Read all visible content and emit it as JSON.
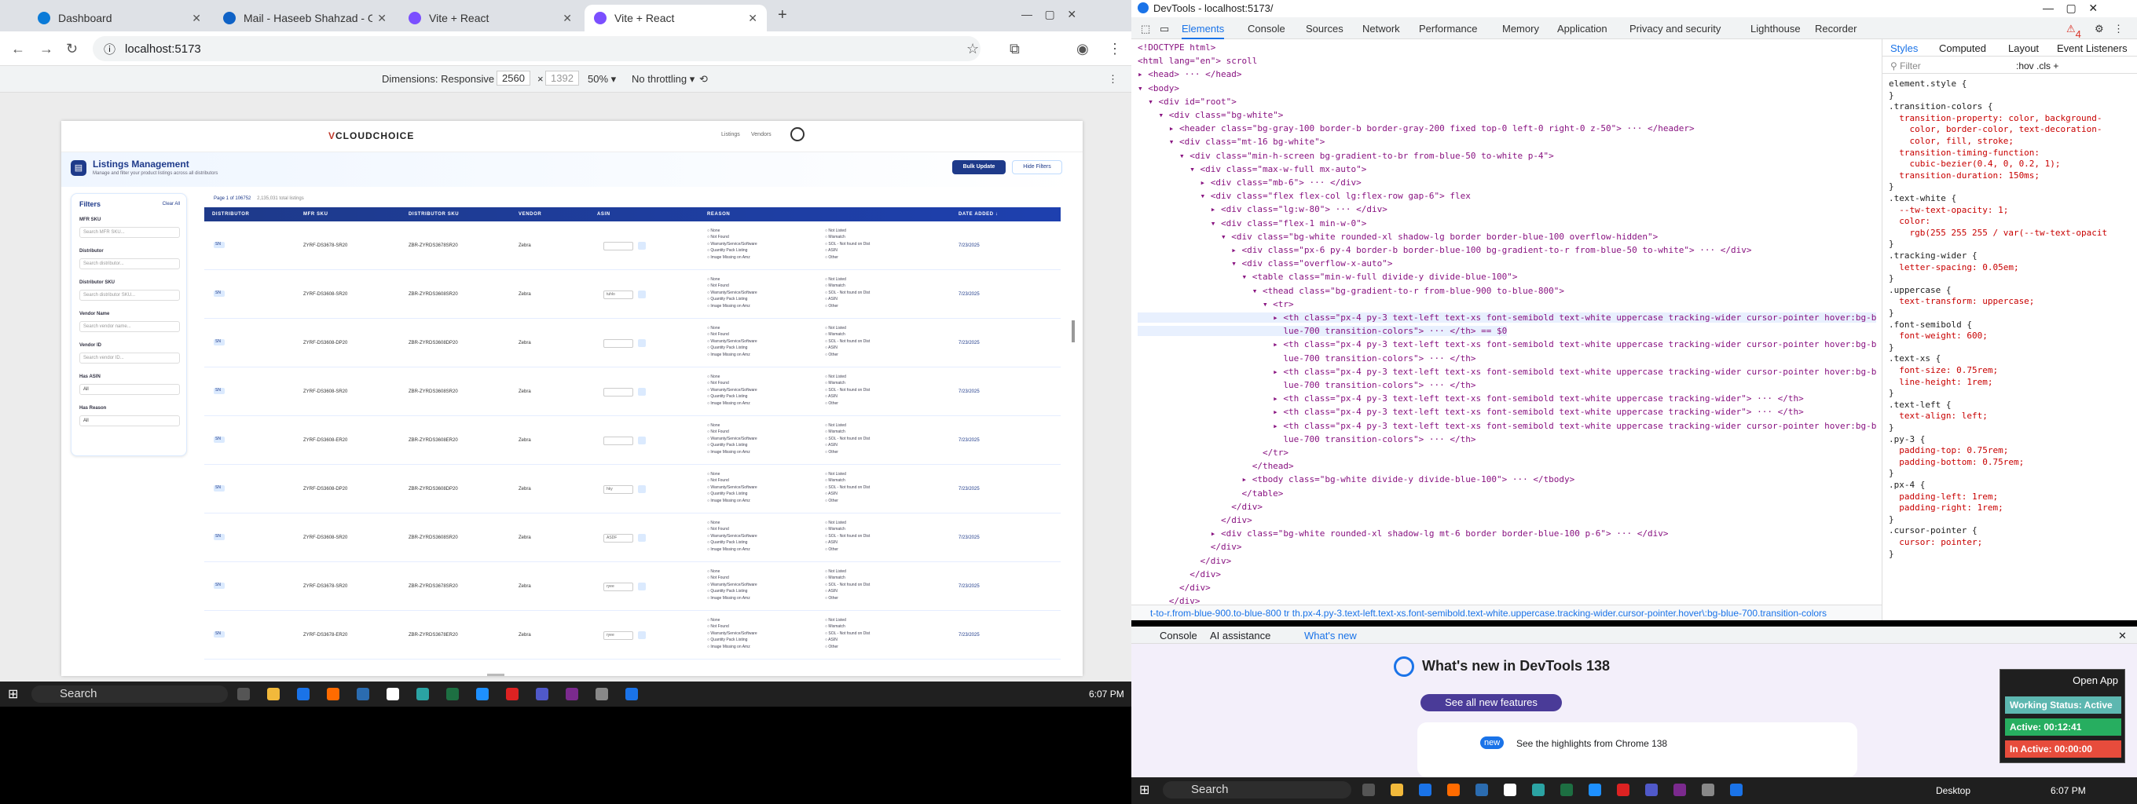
{
  "browser": {
    "tabs": [
      {
        "label": "Dashboard",
        "color": "#0b7bd8"
      },
      {
        "label": "Mail - Haseeb Shahzad - Outlo",
        "color": "#0f62c6"
      },
      {
        "label": "Vite + React",
        "color": "#7b4fff"
      },
      {
        "label": "Vite + React",
        "color": "#7b4fff"
      }
    ],
    "url": "localhost:5173",
    "device_toolbar": {
      "dimensions_label": "Dimensions: Responsive ▾",
      "width": "2560",
      "x": "×",
      "height": "1392",
      "zoom": "50% ▾",
      "throttle": "No throttling ▾"
    }
  },
  "app": {
    "logo_prefix": "V",
    "logo": "CLOUDCHOICE",
    "nav": [
      "Listings",
      "Vendors"
    ],
    "title": "Listings Management",
    "subtitle": "Manage and filter your product listings across all distributors",
    "bulk_button": "Bulk Update",
    "hide_filters_button": "Hide Filters",
    "filters": {
      "title": "Filters",
      "clear": "Clear All",
      "fields": [
        {
          "label": "MFR SKU",
          "placeholder": "Search MFR SKU..."
        },
        {
          "label": "Distributor",
          "placeholder": "Search distributor..."
        },
        {
          "label": "Distributor SKU",
          "placeholder": "Search distributor SKU..."
        },
        {
          "label": "Vendor Name",
          "placeholder": "Search vendor name..."
        },
        {
          "label": "Vendor ID",
          "placeholder": "Search vendor ID..."
        },
        {
          "label": "Has ASIN",
          "placeholder": "All"
        },
        {
          "label": "Has Reason",
          "placeholder": "All"
        }
      ]
    },
    "page_info": "Page 1 of 106752",
    "total_listings": "2,135,031 total listings",
    "columns": [
      "Distributor",
      "MFR SKU",
      "Distributor SKU",
      "Vendor",
      "ASIN",
      "Reason",
      "Date Added ↓"
    ],
    "reasons_left": [
      "None",
      "Not Found",
      "Warranty/Service/Software",
      "Quantity Pack Listing",
      "Image Missing on Amz"
    ],
    "reasons_right": [
      "Not Listed",
      "Mismatch",
      "SOL - Not found on Dist",
      "ASIN",
      "Other"
    ],
    "rows": [
      {
        "distributor": "SN",
        "mfr": "ZYRF-DS3678-SR20",
        "dist": "ZBR-ZYRDS3678SR20",
        "vendor": "Zebra",
        "asin": "",
        "date": "7/23/2025"
      },
      {
        "distributor": "SN",
        "mfr": "ZYRF-DS3608-SR20",
        "dist": "ZBR-ZYRDS3608SR20",
        "vendor": "Zebra",
        "asin": "tuhlo",
        "date": "7/23/2025"
      },
      {
        "distributor": "SN",
        "mfr": "ZYRF-DS3608-DP20",
        "dist": "ZBR-ZYRDS3608DP20",
        "vendor": "Zebra",
        "asin": "",
        "date": "7/23/2025"
      },
      {
        "distributor": "SN",
        "mfr": "ZYRF-DS3608-SR20",
        "dist": "ZBR-ZYRDS3608SR20",
        "vendor": "Zebra",
        "asin": "",
        "date": "7/23/2025"
      },
      {
        "distributor": "SN",
        "mfr": "ZYRF-DS3608-ER20",
        "dist": "ZBR-ZYRDS3608ER20",
        "vendor": "Zebra",
        "asin": "",
        "date": "7/23/2025"
      },
      {
        "distributor": "SN",
        "mfr": "ZYRF-DS3608-DP20",
        "dist": "ZBR-ZYRDS3608DP20",
        "vendor": "Zebra",
        "asin": "hky",
        "date": "7/23/2025"
      },
      {
        "distributor": "SN",
        "mfr": "ZYRF-DS3608-SR20",
        "dist": "ZBR-ZYRDS3608SR20",
        "vendor": "Zebra",
        "asin": "ASDF",
        "date": "7/23/2025"
      },
      {
        "distributor": "SN",
        "mfr": "ZYRF-DS3678-SR20",
        "dist": "ZBR-ZYRDS3678SR20",
        "vendor": "Zebra",
        "asin": "ryee",
        "date": "7/23/2025"
      },
      {
        "distributor": "SN",
        "mfr": "ZYRF-DS3678-ER20",
        "dist": "ZBR-ZYRDS3678ER20",
        "vendor": "Zebra",
        "asin": "ryee",
        "date": "7/23/2025"
      }
    ]
  },
  "taskbar": {
    "search": "Search",
    "time": "6:07 PM",
    "desktop": "Desktop"
  },
  "devtools": {
    "title": "DevTools - localhost:5173/",
    "tabs": [
      "Elements",
      "Console",
      "Sources",
      "Network",
      "Performance",
      "Memory",
      "Application",
      "Privacy and security",
      "Lighthouse",
      "Recorder"
    ],
    "badge": "4",
    "elements": [
      "<!DOCTYPE html>",
      "<html lang=\"en\"> scroll",
      "▸ <head> ··· </head>",
      "▾ <body>",
      "  ▾ <div id=\"root\">",
      "    ▾ <div class=\"bg-white\">",
      "      ▸ <header class=\"bg-gray-100 border-b border-gray-200 fixed top-0 left-0 right-0 z-50\"> ··· </header>",
      "      ▾ <div class=\"mt-16 bg-white\">",
      "        ▾ <div class=\"min-h-screen bg-gradient-to-br from-blue-50 to-white p-4\">",
      "          ▾ <div class=\"max-w-full mx-auto\">",
      "            ▸ <div class=\"mb-6\"> ··· </div>",
      "            ▾ <div class=\"flex flex-col lg:flex-row gap-6\"> flex",
      "              ▸ <div class=\"lg:w-80\"> ··· </div>",
      "              ▾ <div class=\"flex-1 min-w-0\">",
      "                ▾ <div class=\"bg-white rounded-xl shadow-lg border border-blue-100 overflow-hidden\">",
      "                  ▸ <div class=\"px-6 py-4 border-b border-blue-100 bg-gradient-to-r from-blue-50 to-white\"> ··· </div>",
      "                  ▾ <div class=\"overflow-x-auto\">",
      "                    ▾ <table class=\"min-w-full divide-y divide-blue-100\">",
      "                      ▾ <thead class=\"bg-gradient-to-r from-blue-900 to-blue-800\">",
      "                        ▾ <tr>",
      "                          ▸ <th class=\"px-4 py-3 text-left text-xs font-semibold text-white uppercase tracking-wider cursor-pointer hover:bg-b",
      "                            lue-700 transition-colors\"> ··· </th> == $0",
      "                          ▸ <th class=\"px-4 py-3 text-left text-xs font-semibold text-white uppercase tracking-wider cursor-pointer hover:bg-b",
      "                            lue-700 transition-colors\"> ··· </th>",
      "                          ▸ <th class=\"px-4 py-3 text-left text-xs font-semibold text-white uppercase tracking-wider cursor-pointer hover:bg-b",
      "                            lue-700 transition-colors\"> ··· </th>",
      "                          ▸ <th class=\"px-4 py-3 text-left text-xs font-semibold text-white uppercase tracking-wider\"> ··· </th>",
      "                          ▸ <th class=\"px-4 py-3 text-left text-xs font-semibold text-white uppercase tracking-wider\"> ··· </th>",
      "                          ▸ <th class=\"px-4 py-3 text-left text-xs font-semibold text-white uppercase tracking-wider cursor-pointer hover:bg-b",
      "                            lue-700 transition-colors\"> ··· </th>",
      "                        </tr>",
      "                      </thead>",
      "                    ▸ <tbody class=\"bg-white divide-y divide-blue-100\"> ··· </tbody>",
      "                    </table>",
      "                  </div>",
      "                </div>",
      "              ▸ <div class=\"bg-white rounded-xl shadow-lg mt-6 border border-blue-100 p-6\"> ··· </div>",
      "              </div>",
      "            </div>",
      "          </div>",
      "        </div>",
      "      </div>"
    ],
    "breadcrumb": "t-to-r.from-blue-900.to-blue-800   tr   th.px-4.py-3.text-left.text-xs.font-semibold.text-white.uppercase.tracking-wider.cursor-pointer.hover\\:bg-blue-700.transition-colors",
    "styles_tabs": [
      "Styles",
      "Computed",
      "Layout",
      "Event Listeners"
    ],
    "filter_placeholder": "Filter",
    "hov": ":hov  .cls  +",
    "styles": [
      "element.style {",
      "}",
      ".transition-colors {",
      "  transition-property: color, background-",
      "    color, border-color, text-decoration-",
      "    color, fill, stroke;",
      "  transition-timing-function:",
      "    cubic-bezier(0.4, 0, 0.2, 1);",
      "  transition-duration: 150ms;",
      "}",
      ".text-white {",
      "  --tw-text-opacity: 1;",
      "  color:",
      "    rgb(255 255 255 / var(--tw-text-opacit",
      "}",
      ".tracking-wider {",
      "  letter-spacing: 0.05em;",
      "}",
      ".uppercase {",
      "  text-transform: uppercase;",
      "}",
      ".font-semibold {",
      "  font-weight: 600;",
      "}",
      ".text-xs {",
      "  font-size: 0.75rem;",
      "  line-height: 1rem;",
      "}",
      ".text-left {",
      "  text-align: left;",
      "}",
      ".py-3 {",
      "  padding-top: 0.75rem;",
      "  padding-bottom: 0.75rem;",
      "}",
      ".px-4 {",
      "  padding-left: 1rem;",
      "  padding-right: 1rem;",
      "}",
      ".cursor-pointer {",
      "  cursor: pointer;",
      "}"
    ],
    "style_source": "<style>",
    "drawer_tabs": [
      "Console",
      "AI assistance",
      "What's new"
    ],
    "whats_new_title": "What's new in DevTools 138",
    "see_all": "See all new features",
    "highlights": "See the highlights from Chrome 138",
    "new_badge": "new"
  },
  "widget": {
    "open": "Open App",
    "status": "Working Status: Active",
    "active": "Active: 00:12:41",
    "inactive": "In Active: 00:00:00"
  }
}
